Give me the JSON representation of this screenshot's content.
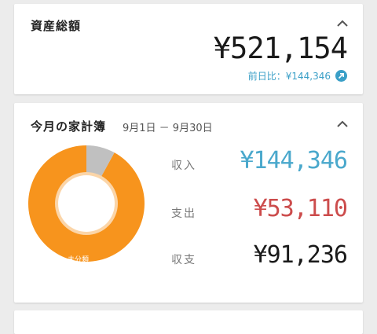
{
  "assets": {
    "title": "資産総額",
    "total": "¥521,154",
    "diff_label": "前日比：¥144,346",
    "icon": "arrow-up-right-icon",
    "accent_color": "#3a9fc7"
  },
  "budget": {
    "title": "今月の家計簿",
    "period": "9月1日 － 9月30日",
    "rows": [
      {
        "label": "収入",
        "value": "¥144,346",
        "color": "#4aa8cc"
      },
      {
        "label": "支出",
        "value": "¥53,110",
        "color": "#cc4c4c"
      },
      {
        "label": "収支",
        "value": "¥91,236",
        "color": "#1a1a1a"
      }
    ],
    "chart": {
      "segments": [
        {
          "label": "未分類",
          "fraction": 0.92,
          "color": "#f7941d"
        },
        {
          "label": "",
          "fraction": 0.08,
          "color": "#c0c0c0"
        }
      ]
    }
  }
}
